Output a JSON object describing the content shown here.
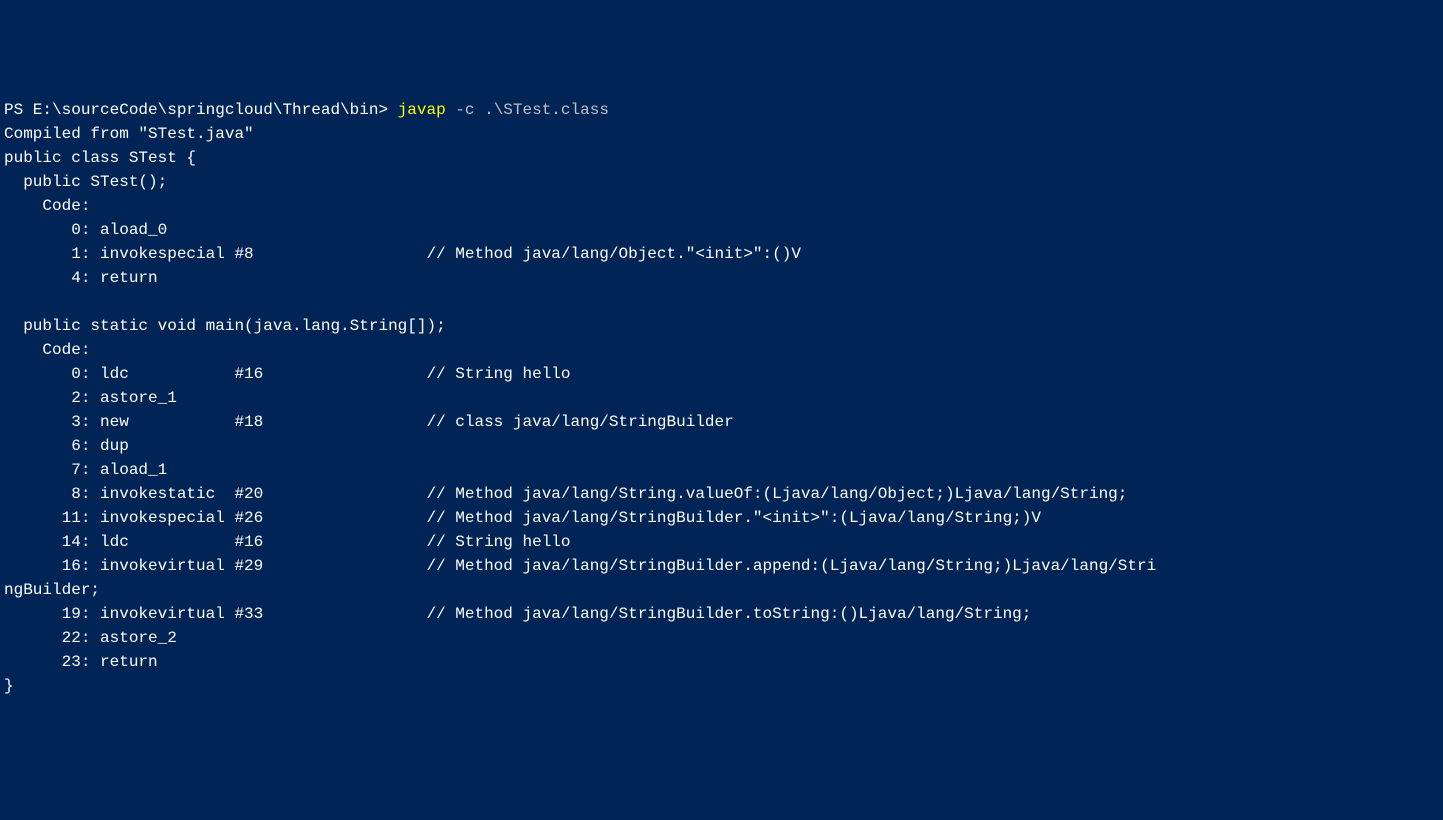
{
  "prompt": {
    "prefix": "PS E:\\sourceCode\\springcloud\\Thread\\bin> ",
    "command": "javap",
    "args": " -c .\\STest.class"
  },
  "output": {
    "line01": "Compiled from \"STest.java\"",
    "line02": "public class STest {",
    "line03": "  public STest();",
    "line04": "    Code:",
    "line05": "       0: aload_0",
    "line06": "       1: invokespecial #8                  // Method java/lang/Object.\"<init>\":()V",
    "line07": "       4: return",
    "line08": "",
    "line09": "  public static void main(java.lang.String[]);",
    "line10": "    Code:",
    "line11": "       0: ldc           #16                 // String hello",
    "line12": "       2: astore_1",
    "line13": "       3: new           #18                 // class java/lang/StringBuilder",
    "line14": "       6: dup",
    "line15": "       7: aload_1",
    "line16": "       8: invokestatic  #20                 // Method java/lang/String.valueOf:(Ljava/lang/Object;)Ljava/lang/String;",
    "line17": "      11: invokespecial #26                 // Method java/lang/StringBuilder.\"<init>\":(Ljava/lang/String;)V",
    "line18": "      14: ldc           #16                 // String hello",
    "line19": "      16: invokevirtual #29                 // Method java/lang/StringBuilder.append:(Ljava/lang/String;)Ljava/lang/Stri",
    "line20": "ngBuilder;",
    "line21": "      19: invokevirtual #33                 // Method java/lang/StringBuilder.toString:()Ljava/lang/String;",
    "line22": "      22: astore_2",
    "line23": "      23: return",
    "line24": "}"
  }
}
